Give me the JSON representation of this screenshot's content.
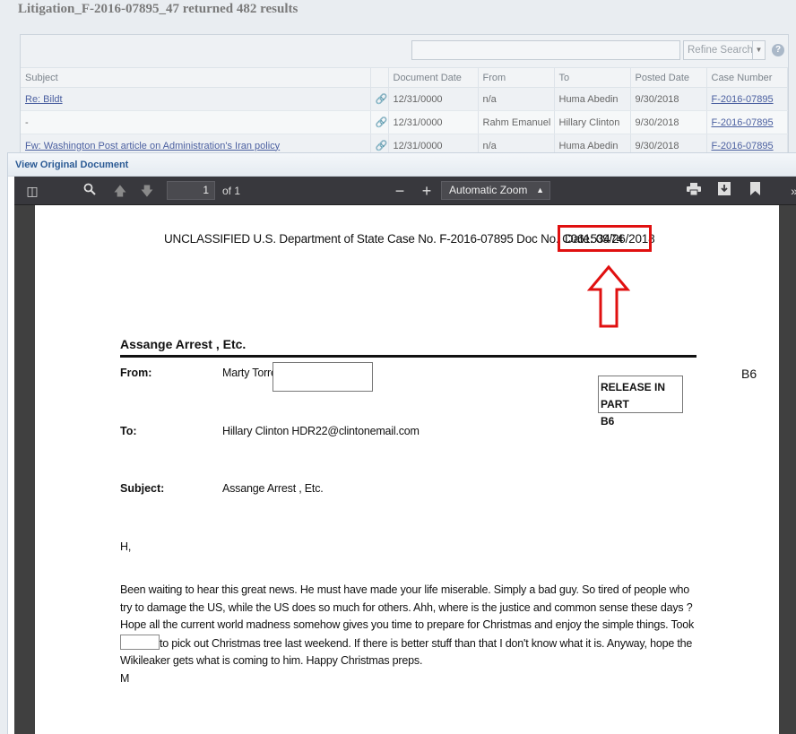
{
  "results": {
    "title": "Litigation_F-2016-07895_47 returned 482 results",
    "search_placeholder": "",
    "refine_label": "Refine Search",
    "columns": [
      "Subject",
      "",
      "Document Date",
      "From",
      "To",
      "Posted Date",
      "Case Number"
    ],
    "rows": [
      {
        "subject": "Re: Bildt",
        "doc_date": "12/31/0000",
        "from": "n/a",
        "to": "Huma Abedin",
        "posted": "9/30/2018",
        "case": "F-2016-07895"
      },
      {
        "subject": "-",
        "doc_date": "12/31/0000",
        "from": "Rahm Emanuel",
        "to": "Hillary Clinton",
        "posted": "9/30/2018",
        "case": "F-2016-07895"
      },
      {
        "subject": "Fw: Washington Post article on Administration's Iran policy",
        "doc_date": "12/31/0000",
        "from": "n/a",
        "to": "Huma Abedin",
        "posted": "9/30/2018",
        "case": "F-2016-07895"
      }
    ]
  },
  "dialog": {
    "title": "View Original Document"
  },
  "viewer": {
    "page_number": "1",
    "page_total": "of 1",
    "zoom": "Automatic Zoom"
  },
  "document": {
    "header": "UNCLASSIFIED U.S. Department of State  Case No. F-2016-07895  Doc No. C06153474",
    "date": "Date: 09/26/2018",
    "title": "Assange Arrest , Etc.",
    "from_label": "From:",
    "from_value": "Marty Torrey",
    "release_line1": "RELEASE IN PART",
    "release_line2": "B6",
    "b6": "B6",
    "to_label": "To:",
    "to_value": "Hillary Clinton HDR22@clintonemail.com",
    "subject_label": "Subject:",
    "subject_value": "Assange Arrest , Etc.",
    "greeting": "H,",
    "body_part1": "Been waiting to hear this great news.  He must have made your life miserable.  Simply a bad guy.  So tired of people who try to damage the US, while the US does so much for others.  Ahh, where is the justice and common sense these days ?  Hope all the current world madness somehow gives you time to prepare for Christmas and enjoy the simple things.  Took ",
    "body_part2": "to pick out Christmas tree last weekend.  If there is better stuff than that I don't know what it is.  Anyway, hope the Wikileaker gets what is coming to him.  Happy Christmas preps.",
    "signature": "M"
  },
  "colors": {
    "highlight": "#e01010",
    "link": "#4a5fa0",
    "dialog_title": "#2b5a94"
  }
}
